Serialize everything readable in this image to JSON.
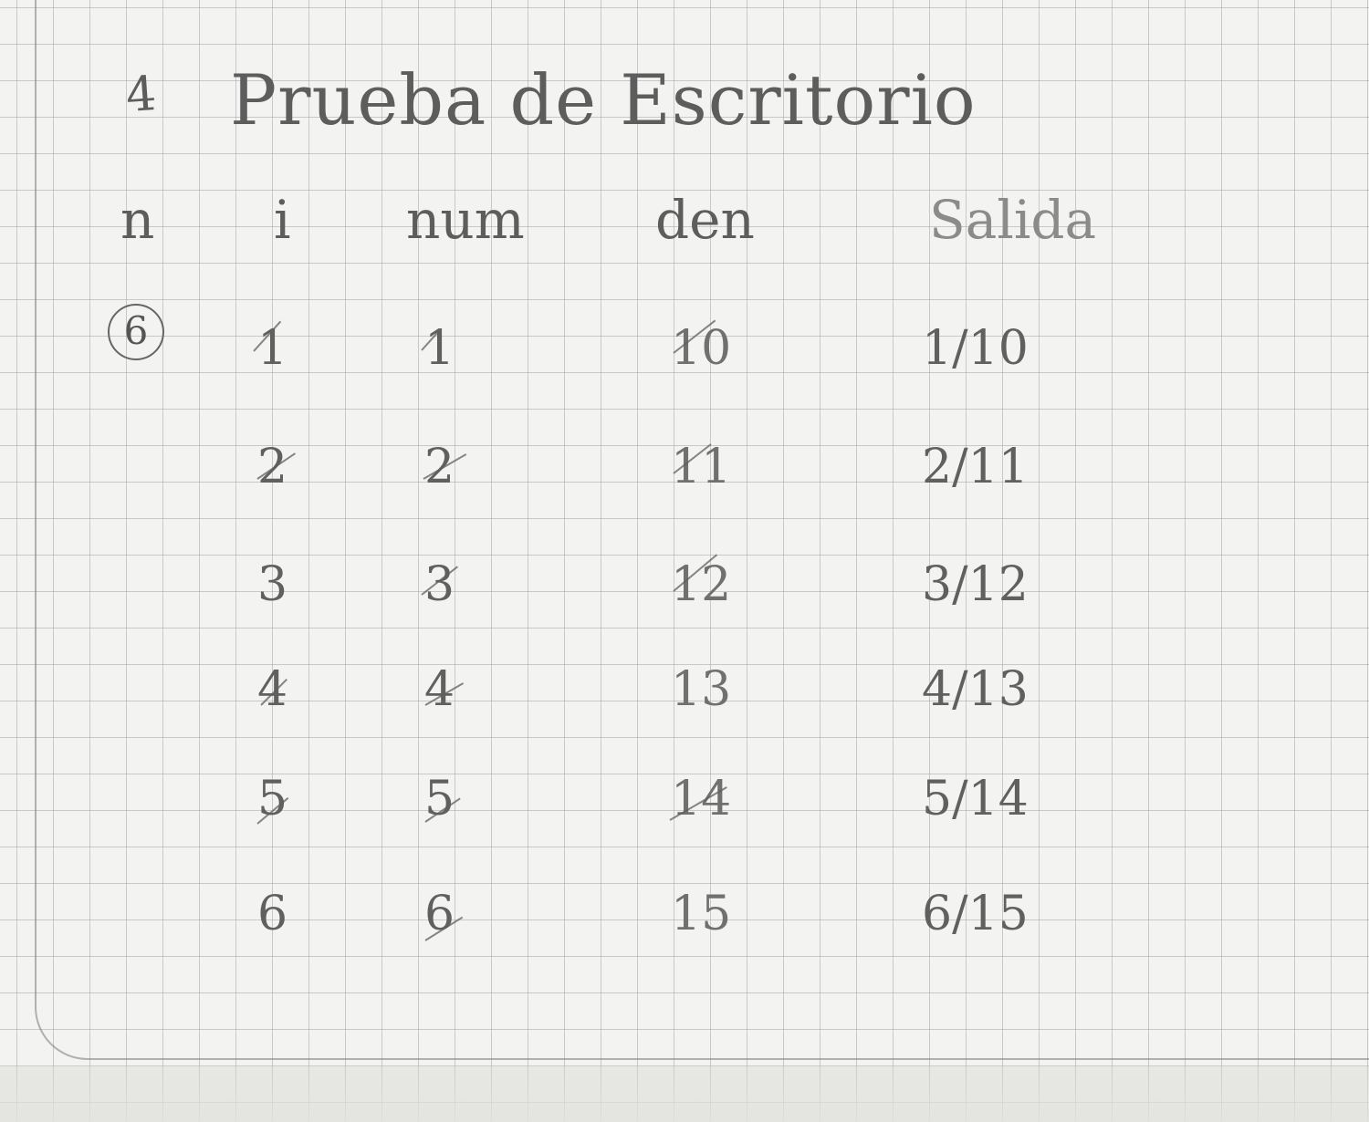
{
  "title": {
    "number": "4",
    "text": "Prueba de Escritorio"
  },
  "headers": [
    "n",
    "i",
    "num",
    "den",
    "Salida"
  ],
  "input_n": "6",
  "rows": [
    {
      "i": "1",
      "num": "1",
      "den": "10",
      "salida": "1/10"
    },
    {
      "i": "2",
      "num": "2",
      "den": "11",
      "salida": "2/11"
    },
    {
      "i": "3",
      "num": "3",
      "den": "12",
      "salida": "3/12"
    },
    {
      "i": "4",
      "num": "4",
      "den": "13",
      "salida": "4/13"
    },
    {
      "i": "5",
      "num": "5",
      "den": "14",
      "salida": "5/14"
    },
    {
      "i": "6",
      "num": "6",
      "den": "15",
      "salida": "6/15"
    }
  ]
}
